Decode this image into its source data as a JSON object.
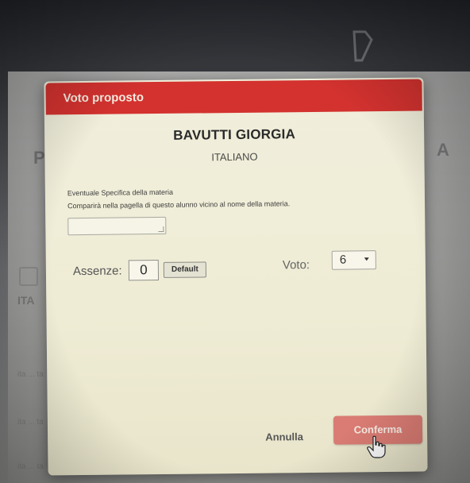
{
  "background": {
    "letter_p": "P",
    "letter_a": "A",
    "row_label": "ITA",
    "row_texts": [
      "ita ... ta",
      "ita ... ta",
      "ita ... ta"
    ]
  },
  "modal": {
    "title": "Voto proposto",
    "student_name": "BAVUTTI GIORGIA",
    "subject": "ITALIANO",
    "spec_label": "Eventuale Specifica della materia",
    "spec_help": "Comparirà nella pagella di questo alunno vicino al nome della materia.",
    "spec_value": "",
    "assenze_label": "Assenze:",
    "assenze_value": "0",
    "default_label": "Default",
    "voto_label": "Voto:",
    "voto_value": "6",
    "cancel_label": "Annulla",
    "confirm_label": "Conferma"
  },
  "colors": {
    "header": "#d3322f",
    "confirm_button": "#da7c74",
    "modal_bg": "#efecd5"
  },
  "icons": [
    "chevron-down-icon",
    "hand-cursor-icon",
    "resize-grip-icon"
  ]
}
